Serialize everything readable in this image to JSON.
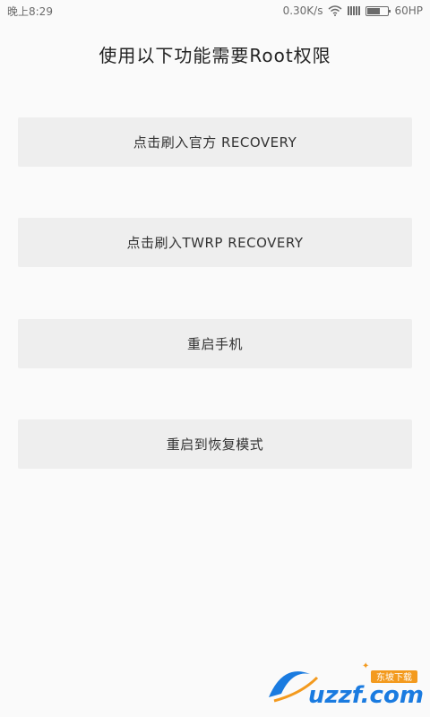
{
  "status_bar": {
    "time": "晚上8:29",
    "network_speed": "0.30K/s",
    "battery_label": "60HP",
    "battery_level": 0.6
  },
  "title": "使用以下功能需要Root权限",
  "buttons": [
    {
      "label": "点击刷入官方 RECOVERY"
    },
    {
      "label": "点击刷入TWRP RECOVERY"
    },
    {
      "label": "重启手机"
    },
    {
      "label": "重启到恢复模式"
    }
  ],
  "watermark": {
    "brand": "uzzf.com",
    "subtitle": "东坡下载",
    "colors": {
      "blue": "#1a7be0",
      "orange": "#f39a1e"
    }
  },
  "colors": {
    "background": "#fafafa",
    "button": "#eeeeee",
    "text": "#333333"
  }
}
